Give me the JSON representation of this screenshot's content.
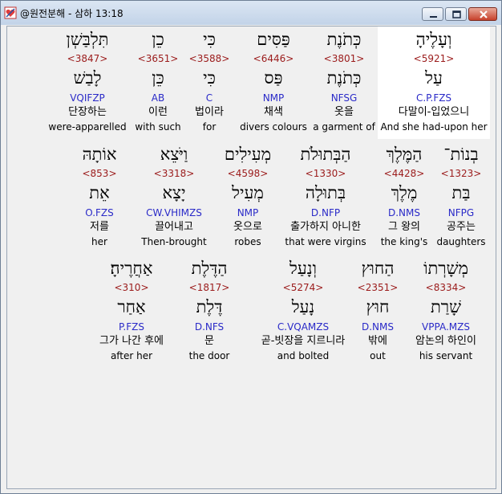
{
  "window": {
    "title": "@원전분해 - 삼하 13:18"
  },
  "rows": [
    [
      {
        "hebrew": "וְעָלֶיהָ",
        "strong": "<5921>",
        "lemma": "עַל",
        "parse": "C.P.FZS",
        "korean": "다말이-입었으니",
        "english": "And she had-upon her",
        "selected": true
      },
      {
        "hebrew": "כְּתֹנֶת",
        "strong": "<3801>",
        "lemma": "כְּתֹנֶת",
        "parse": "NFSG",
        "korean": "옷을",
        "english": "a garment of"
      },
      {
        "hebrew": "פַּסִּים",
        "strong": "<6446>",
        "lemma": "פַּס",
        "parse": "NMP",
        "korean": "채색",
        "english": "divers colours"
      },
      {
        "hebrew": "כִּי",
        "strong": "<3588>",
        "lemma": "כִּי",
        "parse": "C",
        "korean": "법이라",
        "english": "for"
      },
      {
        "hebrew": "כֵן",
        "strong": "<3651>",
        "lemma": "כֵּן",
        "parse": "AB",
        "korean": "이런",
        "english": "with such"
      },
      {
        "hebrew": "תִּלְבַּשְׁן",
        "strong": "<3847>",
        "lemma": "לָבַשׁ",
        "parse": "VQIFZP",
        "korean": "단장하는",
        "english": "were-apparelled"
      }
    ],
    [
      {
        "hebrew": "בְנוֹת־",
        "strong": "<1323>",
        "lemma": "בַּת",
        "parse": "NFPG",
        "korean": "공주는",
        "english": "daughters"
      },
      {
        "hebrew": "הַמֶּלֶךְ",
        "strong": "<4428>",
        "lemma": "מֶלֶךְ",
        "parse": "D.NMS",
        "korean": "그 왕의",
        "english": "the king's"
      },
      {
        "hebrew": "הַבְּתוּלֹת",
        "strong": "<1330>",
        "lemma": "בְּתוּלָה",
        "parse": "D.NFP",
        "korean": "출가하지 아니한",
        "english": "that were virgins"
      },
      {
        "hebrew": "מְעִילִים",
        "strong": "<4598>",
        "lemma": "מְעִיל",
        "parse": "NMP",
        "korean": "옷으로",
        "english": "robes"
      },
      {
        "hebrew": "וַיֹּצֵא",
        "strong": "<3318>",
        "lemma": "יָצָא",
        "parse": "CW.VHIMZS",
        "korean": "끌어내고",
        "english": "Then-brought"
      },
      {
        "hebrew": "אוֹתָהּ",
        "strong": "<853>",
        "lemma": "אֵת",
        "parse": "O.FZS",
        "korean": "저를",
        "english": "her"
      }
    ],
    [
      {
        "hebrew": "מְשָׁרְתוֹ",
        "strong": "<8334>",
        "lemma": "שָׁרַת",
        "parse": "VPPA.MZS",
        "korean": "암논의 하인이",
        "english": "his servant"
      },
      {
        "hebrew": "הַחוּץ",
        "strong": "<2351>",
        "lemma": "חוּץ",
        "parse": "D.NMS",
        "korean": "밖에",
        "english": "out"
      },
      {
        "hebrew": "וְנָעַל",
        "strong": "<5274>",
        "lemma": "נָעַל",
        "parse": "C.VQAMZS",
        "korean": "곧-빗장을 지르니라",
        "english": "and bolted"
      },
      {
        "hebrew": "הַדֶּלֶת",
        "strong": "<1817>",
        "lemma": "דֶּלֶת",
        "parse": "D.NFS",
        "korean": "문",
        "english": "the door"
      },
      {
        "hebrew": "אַחֲרֶיהָ׃",
        "strong": "<310>",
        "lemma": "אַחַר",
        "parse": "P.FZS",
        "korean": "그가 나간 후에",
        "english": "after her"
      }
    ]
  ]
}
